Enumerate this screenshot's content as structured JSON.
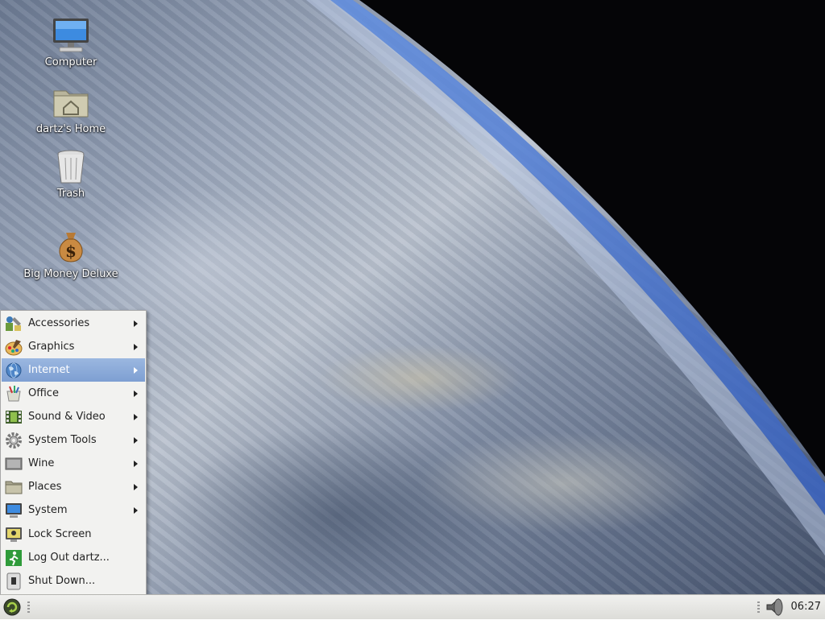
{
  "desktop": {
    "icons": [
      {
        "label": "Computer",
        "icon": "computer-icon"
      },
      {
        "label": "dartz's Home",
        "icon": "home-folder-icon"
      },
      {
        "label": "Trash",
        "icon": "trash-icon"
      },
      {
        "label": "Big Money Deluxe",
        "icon": "money-bag-icon"
      }
    ]
  },
  "menu": {
    "items": [
      {
        "label": "Accessories",
        "icon": "accessories-icon",
        "submenu": true
      },
      {
        "label": "Graphics",
        "icon": "graphics-icon",
        "submenu": true
      },
      {
        "label": "Internet",
        "icon": "internet-globe-icon",
        "submenu": true,
        "active": true
      },
      {
        "label": "Office",
        "icon": "office-icon",
        "submenu": true
      },
      {
        "label": "Sound & Video",
        "icon": "sound-video-icon",
        "submenu": true
      },
      {
        "label": "System Tools",
        "icon": "system-tools-gear-icon",
        "submenu": true
      },
      {
        "label": "Wine",
        "icon": "wine-icon",
        "submenu": true
      },
      {
        "label": "Places",
        "icon": "places-folder-icon",
        "submenu": true
      },
      {
        "label": "System",
        "icon": "system-monitor-icon",
        "submenu": true
      },
      {
        "label": "Lock Screen",
        "icon": "lock-screen-icon",
        "submenu": false
      },
      {
        "label": "Log Out dartz...",
        "icon": "log-out-icon",
        "submenu": false
      },
      {
        "label": "Shut Down...",
        "icon": "shut-down-icon",
        "submenu": false
      }
    ]
  },
  "taskbar": {
    "clock": "06:27",
    "start_icon": "start-menu-icon",
    "volume_icon": "volume-speaker-icon"
  },
  "colors": {
    "menu_highlight": "#8aa9d8",
    "menu_bg": "#f2f2f0",
    "taskbar_bg": "#e6e6e3"
  }
}
